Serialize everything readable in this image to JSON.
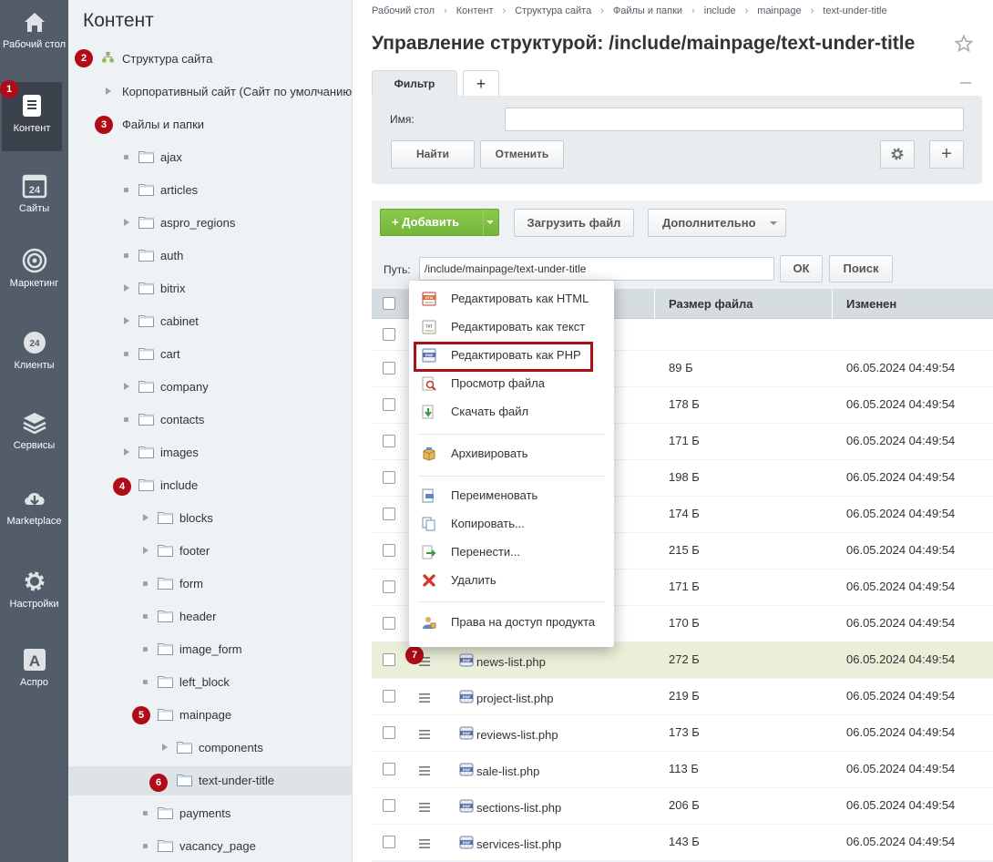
{
  "left_nav": [
    {
      "id": "desktop",
      "label": "Рабочий стол",
      "icon": "home-icon"
    },
    {
      "id": "content",
      "label": "Контент",
      "icon": "document-icon",
      "active": true
    },
    {
      "id": "sites",
      "label": "Сайты",
      "icon": "calendar-24-icon"
    },
    {
      "id": "marketing",
      "label": "Маркетинг",
      "icon": "target-icon"
    },
    {
      "id": "clients",
      "label": "Клиенты",
      "icon": "clients-24-icon"
    },
    {
      "id": "services",
      "label": "Сервисы",
      "icon": "layers-icon"
    },
    {
      "id": "marketplace",
      "label": "Marketplace",
      "icon": "cloud-download-icon"
    },
    {
      "id": "settings",
      "label": "Настройки",
      "icon": "gear-icon"
    },
    {
      "id": "aspro",
      "label": "Аспро",
      "icon": "letter-a-icon"
    }
  ],
  "badges": {
    "b1": "1",
    "b2": "2",
    "b3": "3",
    "b4": "4",
    "b5": "5",
    "b6": "6",
    "b7": "7"
  },
  "tree": {
    "title": "Контент",
    "items": [
      {
        "label": "Структура сайта"
      },
      {
        "label": "Корпоративный сайт (Сайт по умолчанию)"
      },
      {
        "label": "Файлы и папки"
      },
      {
        "label": "ajax"
      },
      {
        "label": "articles"
      },
      {
        "label": "aspro_regions"
      },
      {
        "label": "auth"
      },
      {
        "label": "bitrix"
      },
      {
        "label": "cabinet"
      },
      {
        "label": "cart"
      },
      {
        "label": "company"
      },
      {
        "label": "contacts"
      },
      {
        "label": "images"
      },
      {
        "label": "include"
      },
      {
        "label": "blocks"
      },
      {
        "label": "footer"
      },
      {
        "label": "form"
      },
      {
        "label": "header"
      },
      {
        "label": "image_form"
      },
      {
        "label": "left_block"
      },
      {
        "label": "mainpage"
      },
      {
        "label": "components"
      },
      {
        "label": "text-under-title"
      },
      {
        "label": "payments"
      },
      {
        "label": "vacancy_page"
      }
    ]
  },
  "breadcrumb": [
    "Рабочий стол",
    "Контент",
    "Структура сайта",
    "Файлы и папки",
    "include",
    "mainpage",
    "text-under-title"
  ],
  "page_title": "Управление структурой: /include/mainpage/text-under-title",
  "filter": {
    "tab_label": "Фильтр",
    "add_tab": "+",
    "name_label": "Имя:",
    "name_value": "",
    "find": "Найти",
    "cancel": "Отменить",
    "plus": "+"
  },
  "toolbar": {
    "add": "+ Добавить",
    "upload": "Загрузить файл",
    "more": "Дополнительно"
  },
  "path": {
    "label": "Путь:",
    "value": "/include/mainpage/text-under-title",
    "ok": "ОК",
    "search": "Поиск"
  },
  "table": {
    "columns": [
      "Размер файла",
      "Изменен"
    ],
    "rows": [
      {
        "name": "",
        "size": "",
        "date": ""
      },
      {
        "name": "",
        "size": "89 Б",
        "date": "06.05.2024 04:49:54"
      },
      {
        "name": "",
        "size": "178 Б",
        "date": "06.05.2024 04:49:54"
      },
      {
        "name": "",
        "size": "171 Б",
        "date": "06.05.2024 04:49:54"
      },
      {
        "name": "",
        "size": "198 Б",
        "date": "06.05.2024 04:49:54"
      },
      {
        "name": "",
        "size": "174 Б",
        "date": "06.05.2024 04:49:54"
      },
      {
        "name": "",
        "size": "215 Б",
        "date": "06.05.2024 04:49:54"
      },
      {
        "name": "",
        "size": "171 Б",
        "date": "06.05.2024 04:49:54"
      },
      {
        "name": "",
        "size": "170 Б",
        "date": "06.05.2024 04:49:54"
      },
      {
        "name": "news-list.php",
        "size": "272 Б",
        "date": "06.05.2024 04:49:54",
        "highlight": true
      },
      {
        "name": "project-list.php",
        "size": "219 Б",
        "date": "06.05.2024 04:49:54"
      },
      {
        "name": "reviews-list.php",
        "size": "173 Б",
        "date": "06.05.2024 04:49:54"
      },
      {
        "name": "sale-list.php",
        "size": "113 Б",
        "date": "06.05.2024 04:49:54"
      },
      {
        "name": "sections-list.php",
        "size": "206 Б",
        "date": "06.05.2024 04:49:54"
      },
      {
        "name": "services-list.php",
        "size": "143 Б",
        "date": "06.05.2024 04:49:54"
      }
    ]
  },
  "context_menu": [
    {
      "label": "Редактировать как HTML",
      "icon": "html-edit-icon"
    },
    {
      "label": "Редактировать как текст",
      "icon": "text-edit-icon"
    },
    {
      "label": "Редактировать как PHP",
      "icon": "php-edit-icon",
      "highlighted": true
    },
    {
      "label": "Просмотр файла",
      "icon": "magnifier-icon"
    },
    {
      "label": "Скачать файл",
      "icon": "download-icon"
    },
    {
      "label": "Архивировать",
      "icon": "archive-icon"
    },
    {
      "label": "Переименовать",
      "icon": "rename-icon"
    },
    {
      "label": "Копировать...",
      "icon": "copy-icon"
    },
    {
      "label": "Перенести...",
      "icon": "move-icon"
    },
    {
      "label": "Удалить",
      "icon": "delete-icon"
    },
    {
      "label": "Права на доступ продукта",
      "icon": "user-access-icon"
    }
  ],
  "colors": {
    "nav_bg": "#535c69",
    "nav_active": "#3b424c",
    "tree_bg": "#eef2f4",
    "badge": "#b00c17",
    "add_button": "#7bbd3f",
    "highlight_row": "#e9efd8",
    "highlight_border": "#a8101c"
  }
}
